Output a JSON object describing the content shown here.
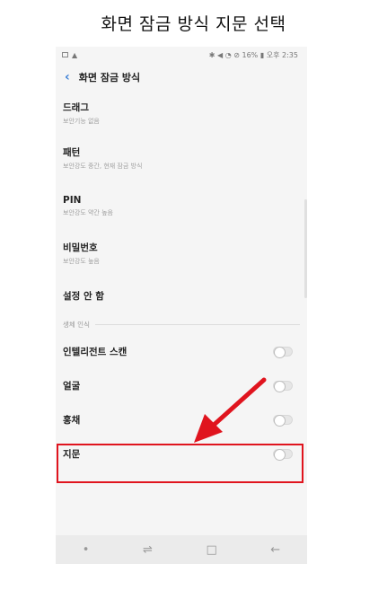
{
  "caption": "화면 잠금 방식 지문 선택",
  "status_bar": {
    "right": "✱ ◀ ◔ ⊘ 16% ▮ 오후 2:35",
    "warn_icon": "▲"
  },
  "app_bar": {
    "title": "화면 잠금 방식",
    "back_icon": "‹"
  },
  "options": [
    {
      "title": "드래그",
      "subtitle": "보안기능 없음"
    },
    {
      "title": "패턴",
      "subtitle": "보안강도 중간, 현재 잠금 방식"
    },
    {
      "title": "PIN",
      "subtitle": "보안강도 약간 높음"
    },
    {
      "title": "비밀번호",
      "subtitle": "보안강도 높음"
    },
    {
      "title": "설정 안 함",
      "subtitle": ""
    }
  ],
  "biometrics": {
    "section_label": "생체 인식",
    "items": [
      {
        "label": "인텔리전트 스캔",
        "enabled": false
      },
      {
        "label": "얼굴",
        "enabled": false
      },
      {
        "label": "홍채",
        "enabled": false
      },
      {
        "label": "지문",
        "enabled": false
      }
    ]
  },
  "nav_bar": {
    "dot": "•",
    "recent": "⇌",
    "home": "□",
    "back": "←"
  },
  "colors": {
    "highlight": "#e0141e",
    "accent": "#3b7fd6"
  }
}
